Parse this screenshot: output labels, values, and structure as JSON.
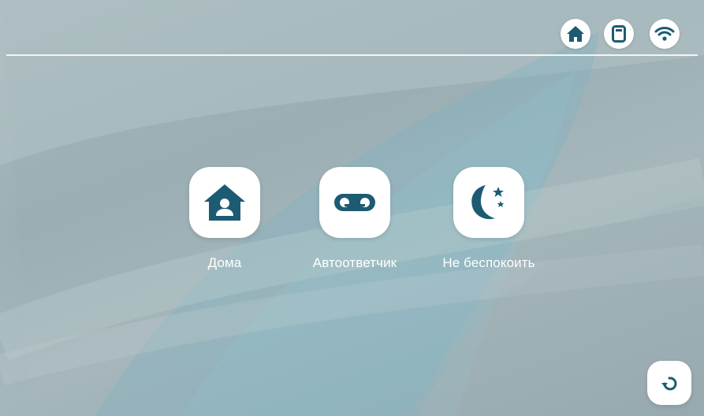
{
  "status_bar": {
    "icons": [
      "home-icon",
      "sd-card-icon",
      "wifi-icon"
    ]
  },
  "modes": [
    {
      "label": "Дома",
      "icon": "home-person-icon"
    },
    {
      "label": "Автоответчик",
      "icon": "voicemail-icon"
    },
    {
      "label": "Не беспокоить",
      "icon": "moon-stars-icon"
    }
  ],
  "controls": {
    "back_icon": "undo-arrow-icon"
  },
  "colors": {
    "accent": "#1d5b73",
    "tile": "#ffffff",
    "text": "#ffffff"
  }
}
